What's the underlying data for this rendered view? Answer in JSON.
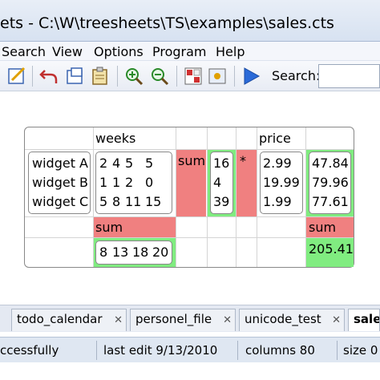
{
  "window": {
    "title": "ets - C:\\W\\treesheets\\TS\\examples\\sales.cts"
  },
  "menu": [
    "Search",
    "View",
    "Options",
    "Program",
    "Help"
  ],
  "toolbar": {
    "icons": [
      "edit-icon",
      "undo-icon",
      "new-doc-icon",
      "paste-icon",
      "zoom-in-icon",
      "zoom-out-icon",
      "grid-icon",
      "image-icon",
      "run-icon"
    ],
    "search_label": "Search:",
    "search_value": ""
  },
  "sheet": {
    "header_weeks": "weeks",
    "header_price": "price",
    "widgets": [
      "widget A",
      "widget B",
      "widget C"
    ],
    "weeks_rows": [
      [
        "2",
        "4",
        "5",
        "5"
      ],
      [
        "1",
        "1",
        "2",
        "0"
      ],
      [
        "5",
        "8",
        "11",
        "15"
      ]
    ],
    "sum_label": "sum",
    "row_sums": [
      "16",
      "4",
      "39"
    ],
    "multiply_sign": "*",
    "prices": [
      "2.99",
      "19.99",
      "1.99"
    ],
    "totals": [
      "47.84",
      "79.96",
      "77.61"
    ],
    "bottom_sum_label": "sum",
    "column_sums": [
      "8",
      "13",
      "18",
      "20"
    ],
    "right_sum_label": "sum",
    "grand_total": "205.41"
  },
  "tabs": [
    {
      "label": "todo_calendar"
    },
    {
      "label": "personel_file"
    },
    {
      "label": "unicode_test"
    },
    {
      "label": "sales"
    }
  ],
  "status": {
    "message": "ccessfully",
    "last_edit": "last edit 9/13/2010",
    "columns": "columns 80",
    "size": "size 0"
  },
  "colors": {
    "sum_red": "#f08080",
    "sum_green": "#80ec80"
  }
}
